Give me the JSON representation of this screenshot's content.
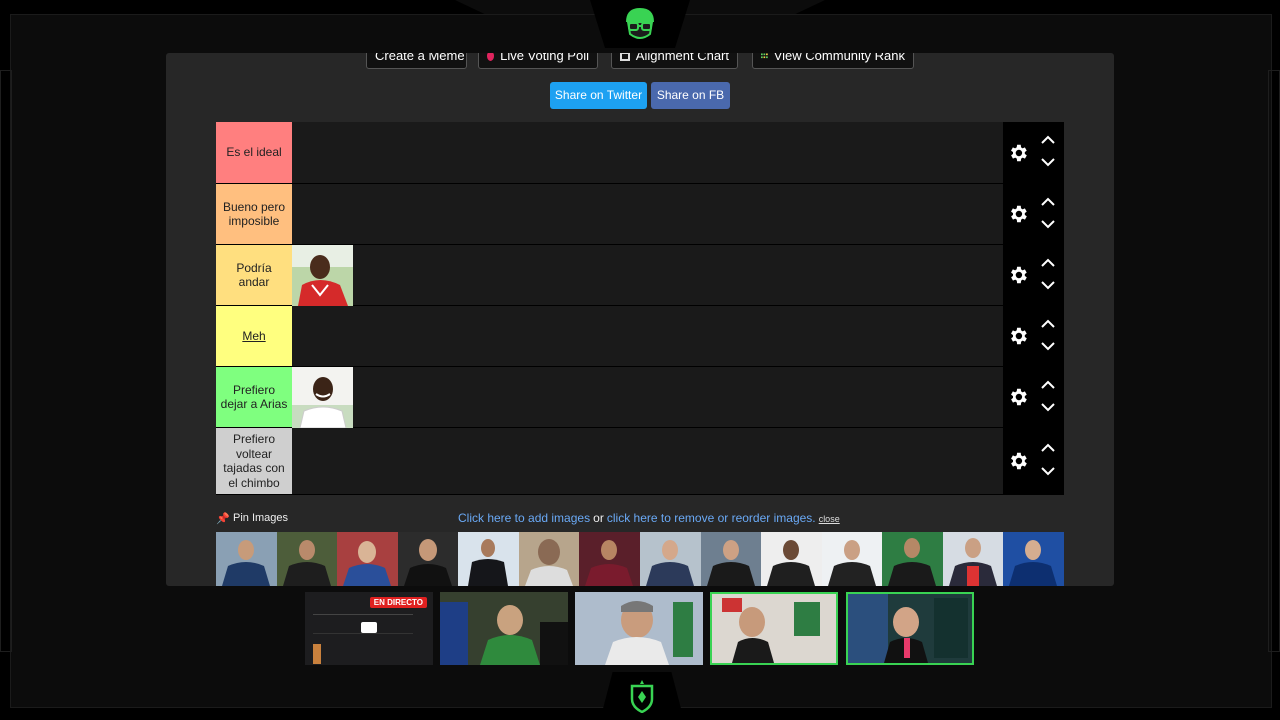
{
  "toolbar": {
    "create_meme": "Create a Meme",
    "live_voting": "Live Voting Poll",
    "alignment_chart": "Alignment Chart",
    "community_rank": "View Community Rank"
  },
  "share": {
    "twitter": "Share on Twitter",
    "fb": "Share on FB"
  },
  "tiers": [
    {
      "label": "Es el ideal",
      "color": "#ff7f7f"
    },
    {
      "label": "Bueno pero imposible",
      "color": "#ffbf7f"
    },
    {
      "label": "Podría andar",
      "color": "#ffdf7f"
    },
    {
      "label": "Meh",
      "color": "#ffff7f"
    },
    {
      "label": "Prefiero dejar a Arias",
      "color": "#7fff7f"
    },
    {
      "label": "Prefiero voltear tajadas con el chimbo",
      "color": "#cfcfcf"
    }
  ],
  "pin": {
    "label": "Pin Images",
    "add_link": "Click here to add images",
    "or": "or",
    "remove_link": "click here to remove or reorder images.",
    "close": "close"
  },
  "stream": {
    "live_badge": "EN DIRECTO"
  },
  "icons": {
    "gear": "gear-icon",
    "up": "chevron-up-icon",
    "down": "chevron-down-icon",
    "pin": "pin-icon",
    "logo": "mascot-glasses-logo",
    "shield": "shield-logo"
  },
  "colors": {
    "twitter": "#1da1f2",
    "facebook": "#4a69ad",
    "link": "#6aa9f5",
    "accent": "#39d353"
  }
}
